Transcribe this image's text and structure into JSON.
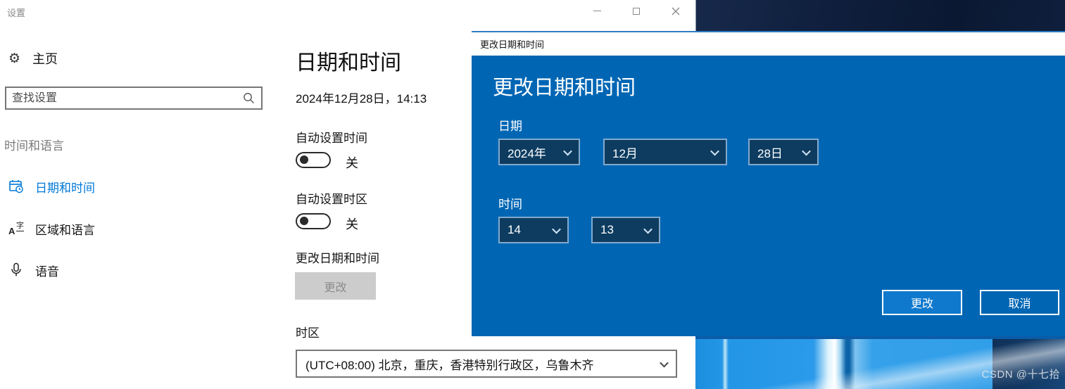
{
  "app_title": "设置",
  "sidebar": {
    "home_label": "主页",
    "search_placeholder": "查找设置",
    "section_header": "时间和语言",
    "items": [
      {
        "label": "日期和时间",
        "selected": true
      },
      {
        "label": "区域和语言",
        "selected": false
      },
      {
        "label": "语音",
        "selected": false
      }
    ]
  },
  "main": {
    "page_title": "日期和时间",
    "current_datetime": "2024年12月28日，14:13",
    "auto_time_label": "自动设置时间",
    "auto_time_state": "关",
    "auto_timezone_label": "自动设置时区",
    "auto_timezone_state": "关",
    "change_datetime_label": "更改日期和时间",
    "change_button_label": "更改",
    "timezone_label": "时区",
    "timezone_value": "(UTC+08:00) 北京，重庆，香港特别行政区，乌鲁木齐"
  },
  "dialog": {
    "titlebar": "更改日期和时间",
    "heading": "更改日期和时间",
    "date_label": "日期",
    "year": "2024年",
    "month": "12月",
    "day": "28日",
    "time_label": "时间",
    "hour": "14",
    "minute": "13",
    "ok_label": "更改",
    "cancel_label": "取消"
  },
  "desktop": {
    "watermark": "CSDN @十七拾"
  },
  "icons": {
    "gear": "⚙",
    "translate_a": "A",
    "translate_zi": "字"
  },
  "colors": {
    "accent": "#0078d7",
    "dialog_blue": "#0066b4",
    "dialog_select_bg": "#0d3c60",
    "disabled_gray": "#cccccc"
  }
}
